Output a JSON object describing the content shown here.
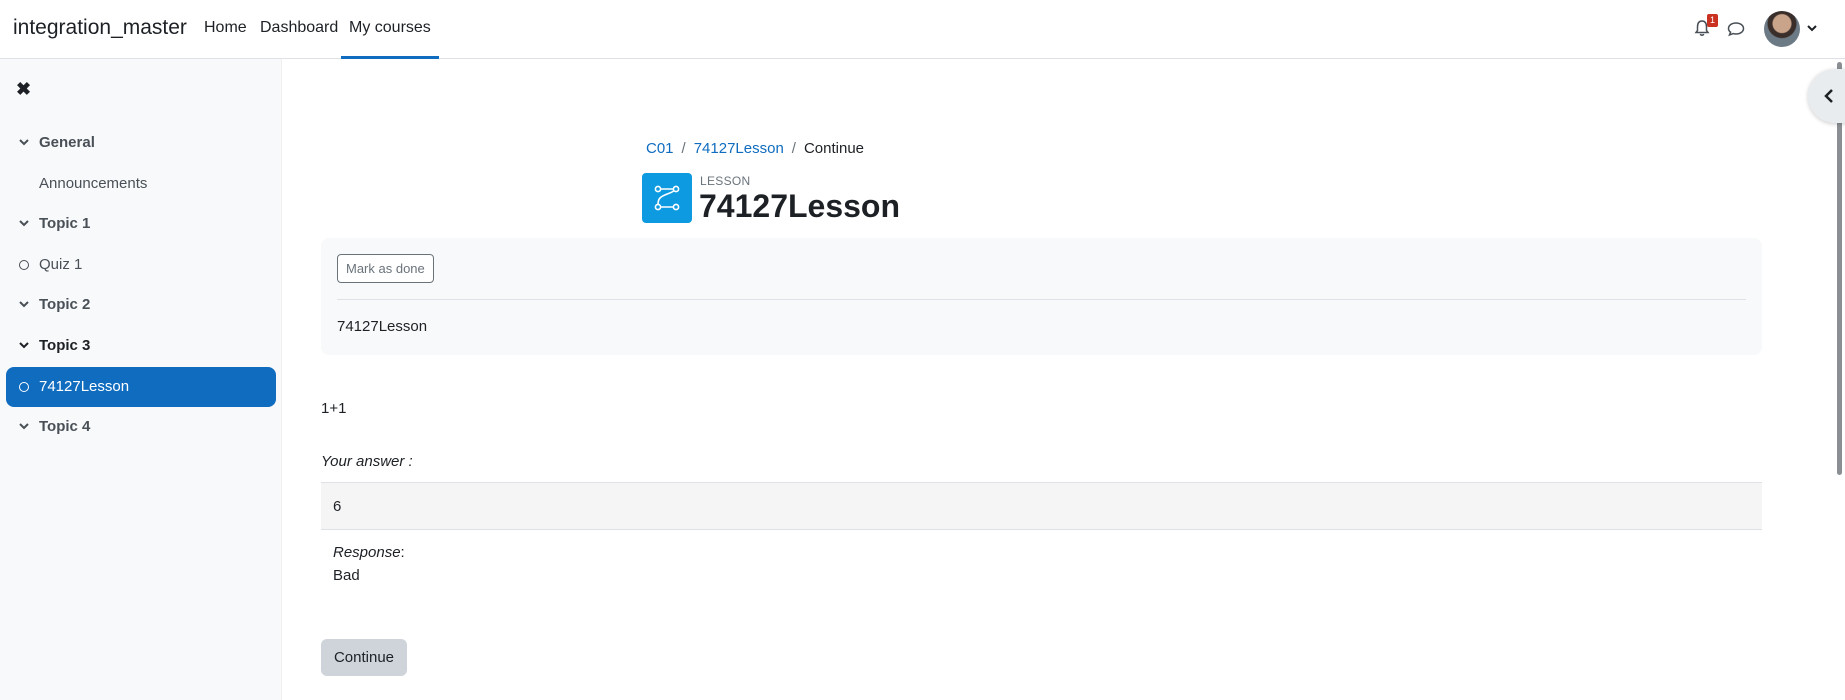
{
  "navbar": {
    "brand": "integration_master",
    "links": [
      "Home",
      "Dashboard",
      "My courses"
    ],
    "notification_count": "1"
  },
  "sidebar": {
    "items": [
      {
        "label": "General",
        "type": "section"
      },
      {
        "label": "Announcements",
        "type": "activity"
      },
      {
        "label": "Topic 1",
        "type": "section"
      },
      {
        "label": "Quiz 1",
        "type": "activity"
      },
      {
        "label": "Topic 2",
        "type": "section"
      },
      {
        "label": "Topic 3",
        "type": "section"
      },
      {
        "label": "74127Lesson",
        "type": "activity",
        "active": true
      },
      {
        "label": "Topic 4",
        "type": "section"
      }
    ]
  },
  "breadcrumb": [
    "C01",
    "74127Lesson",
    "Continue"
  ],
  "header": {
    "pretitle": "LESSON",
    "title": "74127Lesson"
  },
  "activity": {
    "mark_done_label": "Mark as done",
    "description": "74127Lesson"
  },
  "question": {
    "text": "1+1",
    "your_answer_label": "Your answer :",
    "answer_value": "6",
    "response_label": "Response",
    "response_value": "Bad"
  },
  "continue_label": "Continue",
  "colors": {
    "primary": "#0f6cbf",
    "lesson_icon": "#0d9ae1",
    "badge": "#ca3120"
  }
}
